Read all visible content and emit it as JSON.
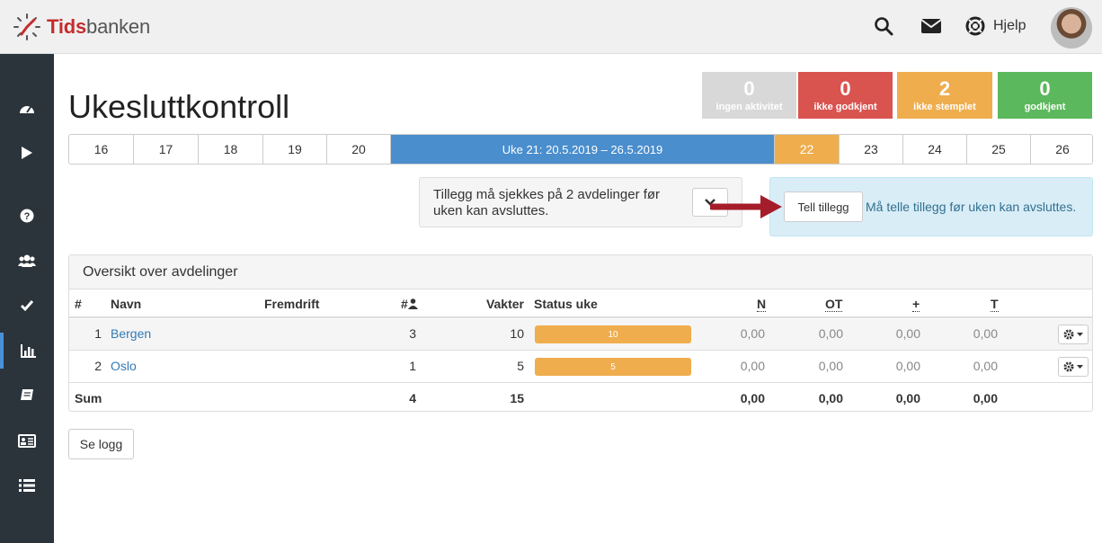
{
  "app": {
    "logo_part1": "Tids",
    "logo_part2": "banken"
  },
  "header": {
    "help_label": "Hjelp"
  },
  "sidebar": {
    "items": [
      {
        "icon": "dashboard-icon"
      },
      {
        "icon": "play-icon"
      },
      {
        "icon": "question-icon"
      },
      {
        "icon": "users-icon"
      },
      {
        "icon": "check-icon"
      },
      {
        "icon": "bar-chart-icon",
        "active": true
      },
      {
        "icon": "book-icon"
      },
      {
        "icon": "id-card-icon"
      },
      {
        "icon": "list-icon"
      }
    ]
  },
  "page": {
    "title": "Ukesluttkontroll"
  },
  "kpis": [
    {
      "value": "0",
      "label": "ingen aktivitet",
      "color": "#d8d8d8"
    },
    {
      "value": "0",
      "label": "ikke godkjent",
      "color": "#d9534f"
    },
    {
      "value": "2",
      "label": "ikke stemplet",
      "color": "#efad4d"
    },
    {
      "value": "0",
      "label": "godkjent",
      "color": "#5cb85c"
    }
  ],
  "weeks": {
    "before": [
      "16",
      "17",
      "18",
      "19",
      "20"
    ],
    "current": "Uke 21: 20.5.2019 – 26.5.2019",
    "warn": "22",
    "after": [
      "23",
      "24",
      "25",
      "26"
    ]
  },
  "notice": {
    "text": "Tillegg må sjekkes på 2 avdelinger før uken kan avsluttes."
  },
  "info": {
    "button": "Tell tillegg",
    "text": "Må telle tillegg før uken kan avsluttes."
  },
  "panel": {
    "title": "Oversikt over avdelinger",
    "headers": {
      "num": "#",
      "name": "Navn",
      "progress": "Fremdrift",
      "count": "#",
      "shifts": "Vakter",
      "status": "Status uke",
      "n": "N",
      "ot": "OT",
      "plus": "+",
      "t": "T"
    },
    "rows": [
      {
        "num": "1",
        "name": "Bergen",
        "count": "3",
        "shifts": "10",
        "bar": "10",
        "n": "0,00",
        "ot": "0,00",
        "plus": "0,00",
        "t": "0,00"
      },
      {
        "num": "2",
        "name": "Oslo",
        "count": "1",
        "shifts": "5",
        "bar": "5",
        "n": "0,00",
        "ot": "0,00",
        "plus": "0,00",
        "t": "0,00"
      }
    ],
    "sum": {
      "label": "Sum",
      "count": "4",
      "shifts": "15",
      "n": "0,00",
      "ot": "0,00",
      "plus": "0,00",
      "t": "0,00"
    }
  },
  "log_button": "Se logg"
}
